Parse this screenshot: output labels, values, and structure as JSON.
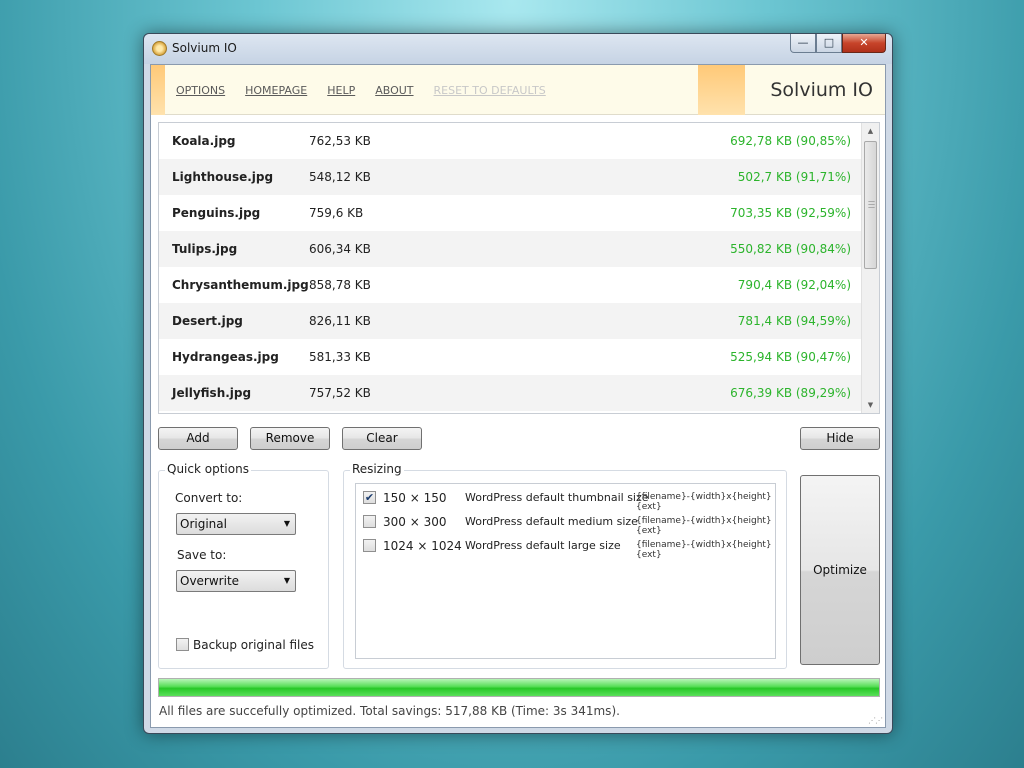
{
  "window": {
    "title": "Solvium IO",
    "min": "—",
    "max": "□",
    "close": "✕"
  },
  "header": {
    "nav": [
      "OPTIONS",
      "HOMEPAGE",
      "HELP",
      "ABOUT",
      "RESET TO DEFAULTS"
    ],
    "brand": "Solvium IO"
  },
  "files": [
    {
      "name": "Koala.jpg",
      "size": "762,53 KB",
      "optimized": "692,78 KB (90,85%)"
    },
    {
      "name": "Lighthouse.jpg",
      "size": "548,12 KB",
      "optimized": "502,7 KB (91,71%)"
    },
    {
      "name": "Penguins.jpg",
      "size": "759,6 KB",
      "optimized": "703,35 KB (92,59%)"
    },
    {
      "name": "Tulips.jpg",
      "size": "606,34 KB",
      "optimized": "550,82 KB (90,84%)"
    },
    {
      "name": "Chrysanthemum.jpg",
      "size": "858,78 KB",
      "optimized": "790,4 KB (92,04%)"
    },
    {
      "name": "Desert.jpg",
      "size": "826,11 KB",
      "optimized": "781,4 KB (94,59%)"
    },
    {
      "name": "Hydrangeas.jpg",
      "size": "581,33 KB",
      "optimized": "525,94 KB (90,47%)"
    },
    {
      "name": "Jellyfish.jpg",
      "size": "757,52 KB",
      "optimized": "676,39 KB (89,29%)"
    }
  ],
  "buttons": {
    "add": "Add",
    "remove": "Remove",
    "clear": "Clear",
    "hide": "Hide",
    "optimize": "Optimize"
  },
  "quick_options": {
    "title": "Quick options",
    "convert_label": "Convert to:",
    "convert_value": "Original",
    "save_label": "Save to:",
    "save_value": "Overwrite",
    "backup_label": "Backup original files",
    "backup_checked": false
  },
  "resizing": {
    "title": "Resizing",
    "items": [
      {
        "checked": true,
        "dim": "150 × 150",
        "desc": "WordPress default thumbnail size",
        "pattern": "{filename}-{width}x{height}{ext}"
      },
      {
        "checked": false,
        "dim": "300 × 300",
        "desc": "WordPress default medium size",
        "pattern": "{filename}-{width}x{height}{ext}"
      },
      {
        "checked": false,
        "dim": "1024 × 1024",
        "desc": "WordPress default large size",
        "pattern": "{filename}-{width}x{height}{ext}"
      }
    ]
  },
  "progress": {
    "value": 1.0
  },
  "status": "All files are succefully optimized. Total savings: 517,88 KB (Time: 3s 341ms).",
  "colors": {
    "saved": "#2cb42c",
    "progress": "#28c828",
    "accent": "#ffc978"
  }
}
